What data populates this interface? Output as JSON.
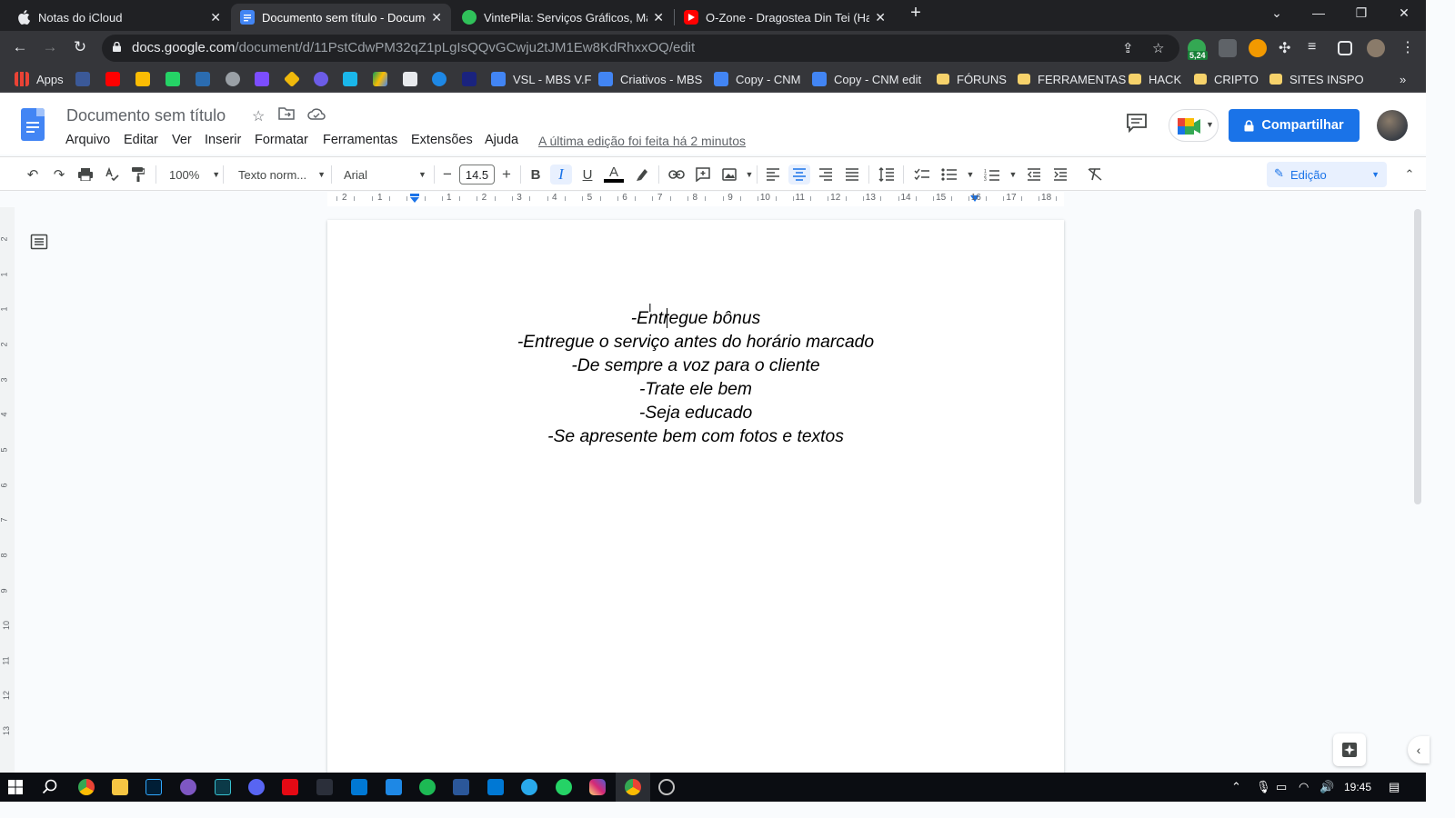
{
  "browser": {
    "tabs": [
      {
        "title": "Notas do iCloud",
        "active": false,
        "favicon": "apple-icon"
      },
      {
        "title": "Documento sem título - Docume",
        "active": true,
        "favicon": "google-docs-icon"
      },
      {
        "title": "VintePila: Serviços Gráficos, Mark",
        "active": false,
        "favicon": "vintepila-icon"
      },
      {
        "title": "O-Zone - Dragostea Din Tei (Har",
        "active": false,
        "favicon": "youtube-icon"
      }
    ],
    "url_host": "docs.google.com",
    "url_path": "/document/d/11PstCdwPM32qZ1pLgIsQQvGCwju2tJM1Ew8KdRhxxOQ/edit",
    "extension_badge": "5,24",
    "bookmarks": [
      {
        "label": "Apps",
        "icon": "apps-grid-icon"
      },
      {
        "label": "VSL - MBS V.F",
        "icon": "docs-icon"
      },
      {
        "label": "Criativos - MBS",
        "icon": "docs-icon"
      },
      {
        "label": "Copy - CNM",
        "icon": "docs-icon"
      },
      {
        "label": "Copy - CNM edit",
        "icon": "docs-icon"
      },
      {
        "label": "FÓRUNS",
        "icon": "folder-icon"
      },
      {
        "label": "FERRAMENTAS",
        "icon": "folder-icon"
      },
      {
        "label": "HACK",
        "icon": "folder-icon"
      },
      {
        "label": "CRIPTO",
        "icon": "folder-icon"
      },
      {
        "label": "SITES INSPO",
        "icon": "folder-icon"
      }
    ]
  },
  "docs": {
    "title": "Documento sem título",
    "menu": [
      "Arquivo",
      "Editar",
      "Ver",
      "Inserir",
      "Formatar",
      "Ferramentas",
      "Extensões",
      "Ajuda"
    ],
    "last_edit": "A última edição foi feita há 2 minutos",
    "share_label": "Compartilhar",
    "toolbar": {
      "zoom": "100%",
      "style": "Texto norm...",
      "font": "Arial",
      "font_size": "14.5",
      "mode": "Edição"
    },
    "ruler_numbers": [
      "2",
      "1",
      "1",
      "2",
      "3",
      "4",
      "5",
      "6",
      "7",
      "8",
      "9",
      "10",
      "11",
      "12",
      "13",
      "14",
      "15",
      "16",
      "17",
      "18"
    ],
    "vruler_numbers": [
      "2",
      "1",
      "1",
      "2",
      "3",
      "4",
      "5",
      "6",
      "7",
      "8",
      "9",
      "10",
      "11",
      "12",
      "13"
    ],
    "body_lines": [
      "-Entregue bônus",
      "-Entregue o serviço antes do horário marcado",
      "-De sempre a voz para o cliente",
      "-Trate ele bem",
      "-Seja educado",
      "-Se apresente bem com fotos e textos"
    ]
  },
  "taskbar": {
    "time": "19:45"
  },
  "colors": {
    "accent": "#1a73e8",
    "docs_blue": "#4285f4",
    "tab_strip": "#202124",
    "toolbar_dark": "#35363a"
  }
}
